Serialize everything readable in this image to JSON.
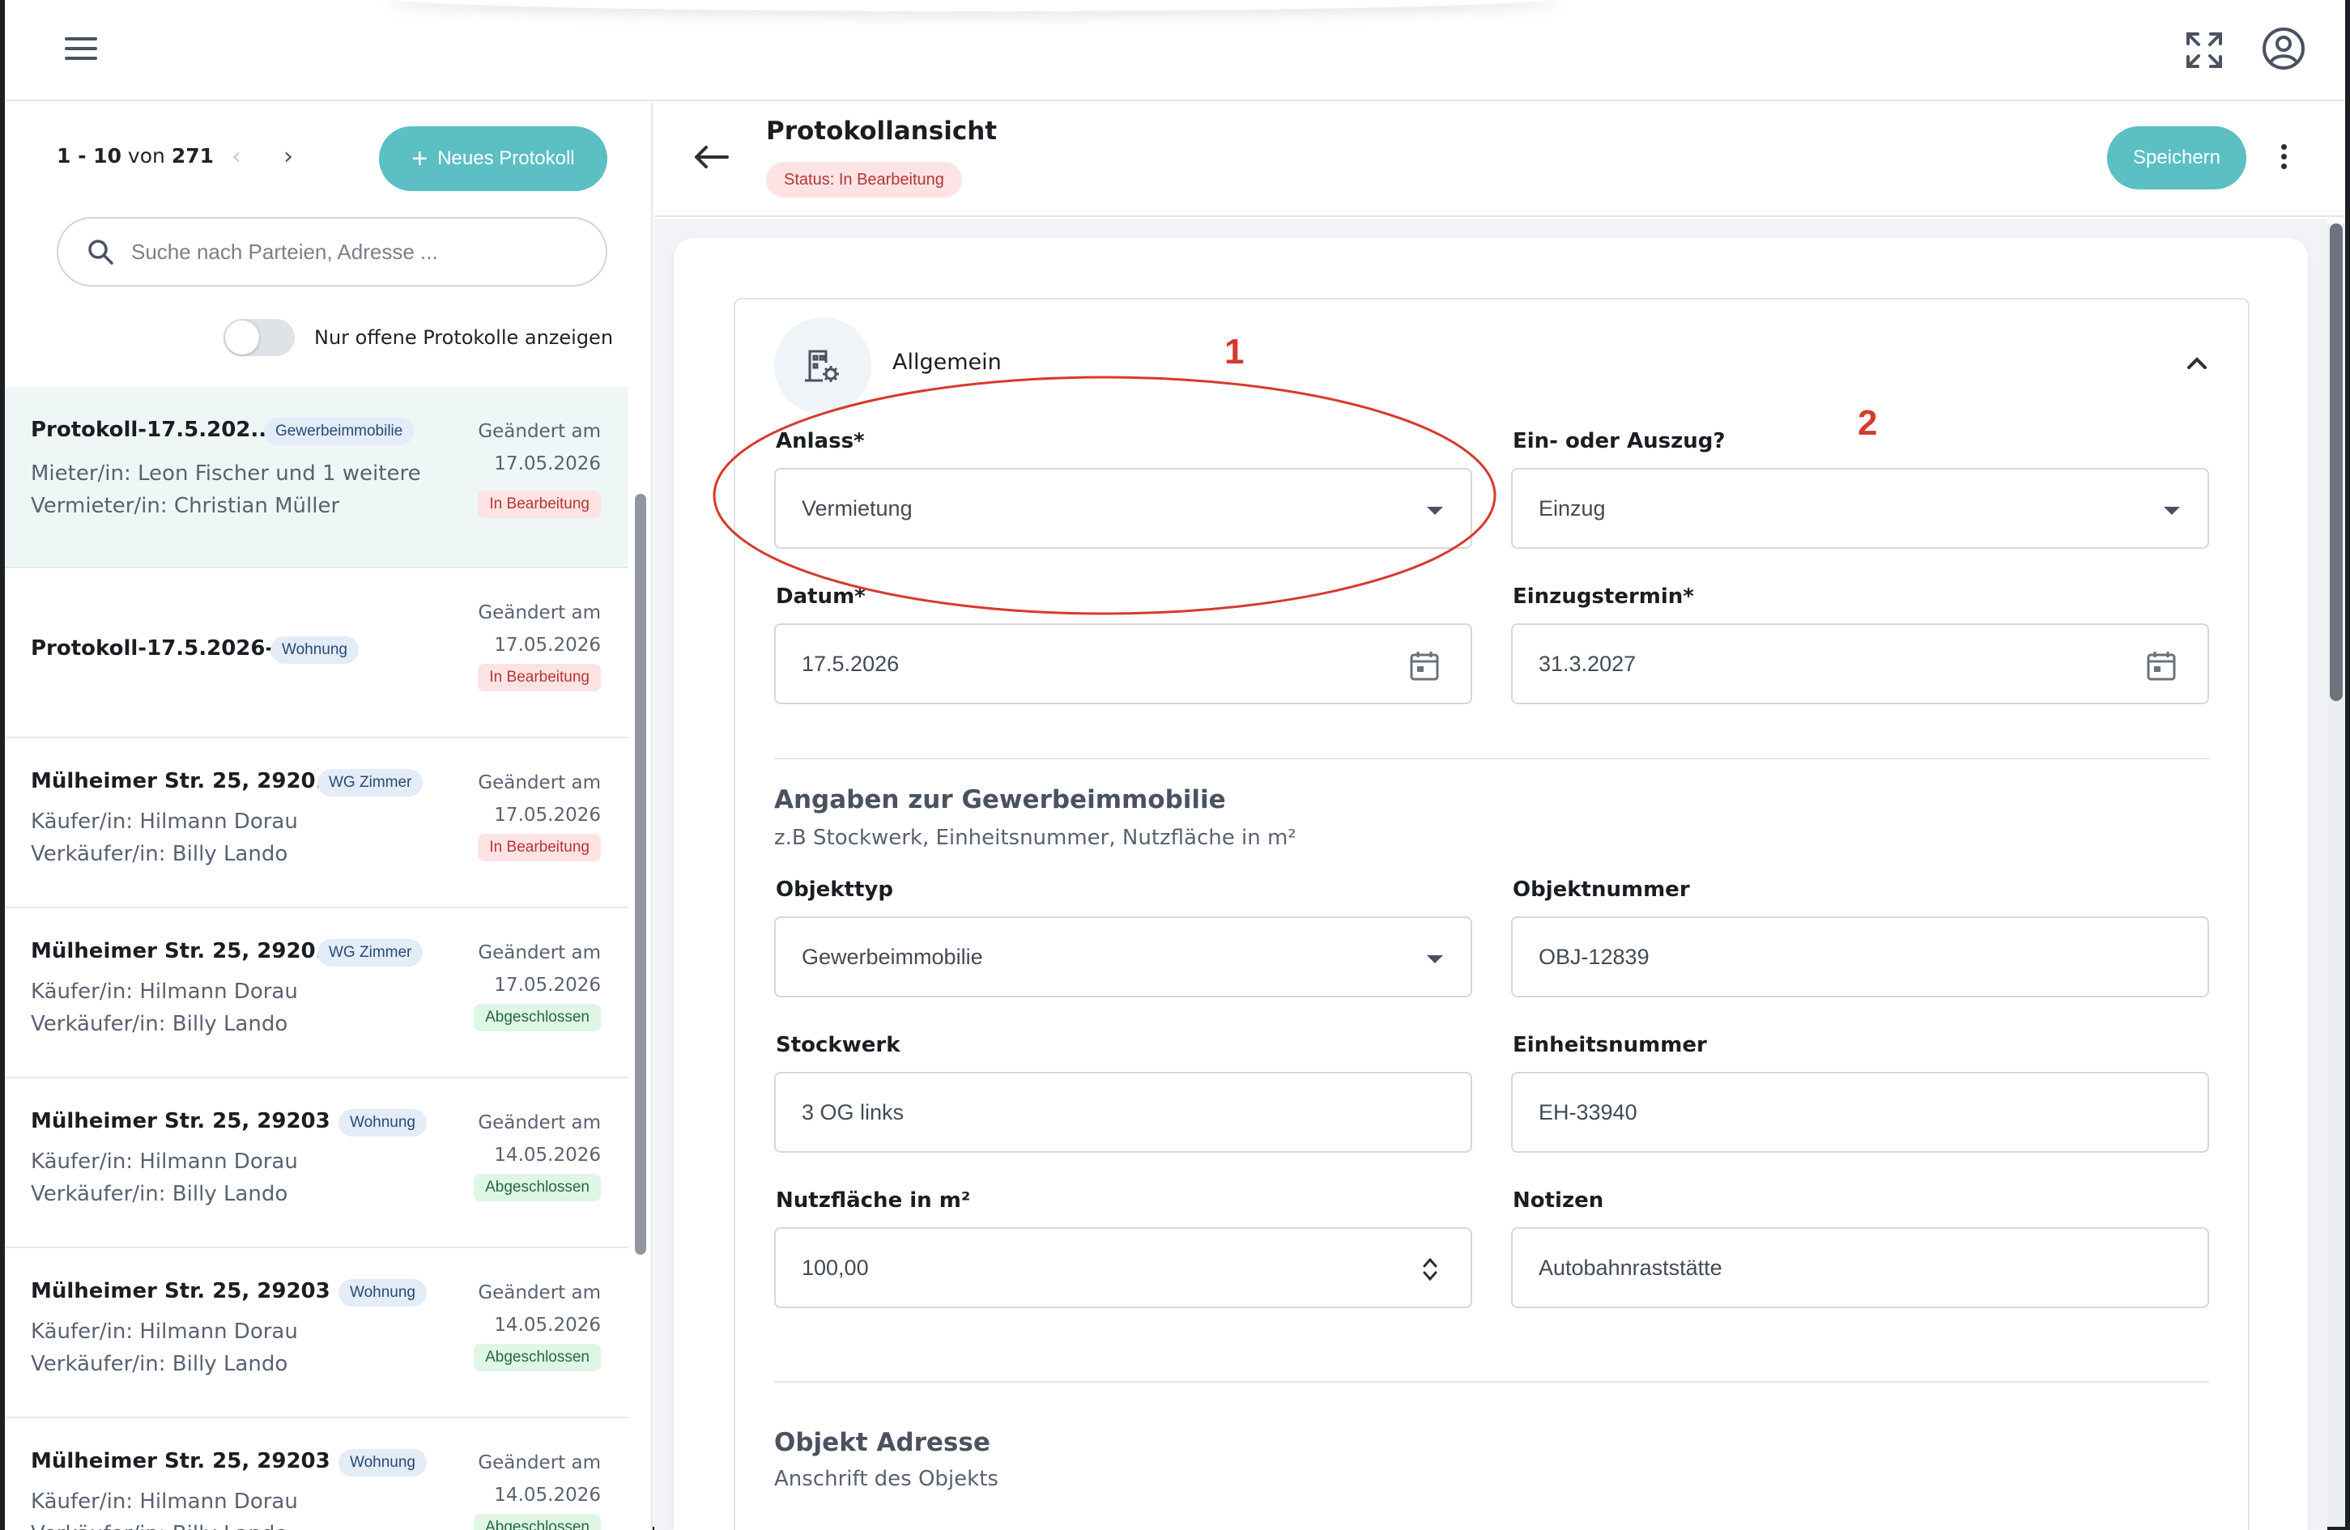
{
  "topbar": {
    "menu_icon": "hamburger-menu-icon",
    "fullscreen_icon": "expand-icon",
    "account_icon": "user-account-icon"
  },
  "left": {
    "pager": {
      "range": "1 - 10",
      "of": "von",
      "total": "271"
    },
    "new_button": "Neues Protokoll",
    "search_placeholder": "Suche nach Parteien, Adresse ...",
    "toggle_label": "Nur offene Protokolle anzeigen",
    "items": [
      {
        "title": "Protokoll-17.5.202...",
        "chip": "Gewerbeimmobilie",
        "line1": "Mieter/in: Leon Fischer und 1 weitere",
        "line2": "Vermieter/in: Christian Müller",
        "changed": "Geändert am",
        "date": "17.05.2026",
        "status": "In Bearbeitung"
      },
      {
        "title": "Protokoll-17.5.2026-2",
        "chip": "Wohnung",
        "line1": "",
        "line2": "",
        "changed": "Geändert am",
        "date": "17.05.2026",
        "status": "In Bearbeitung"
      },
      {
        "title": "Mülheimer Str. 25, 2920...",
        "chip": "WG Zimmer",
        "line1": "Käufer/in: Hilmann Dorau",
        "line2": "Verkäufer/in: Billy Lando",
        "changed": "Geändert am",
        "date": "17.05.2026",
        "status": "In Bearbeitung"
      },
      {
        "title": "Mülheimer Str. 25, 2920...",
        "chip": "WG Zimmer",
        "line1": "Käufer/in: Hilmann Dorau",
        "line2": "Verkäufer/in: Billy Lando",
        "changed": "Geändert am",
        "date": "17.05.2026",
        "status": "Abgeschlossen"
      },
      {
        "title": "Mülheimer Str. 25, 29203 ...",
        "chip": "Wohnung",
        "line1": "Käufer/in: Hilmann Dorau",
        "line2": "Verkäufer/in: Billy Lando",
        "changed": "Geändert am",
        "date": "14.05.2026",
        "status": "Abgeschlossen"
      },
      {
        "title": "Mülheimer Str. 25, 29203 ...",
        "chip": "Wohnung",
        "line1": "Käufer/in: Hilmann Dorau",
        "line2": "Verkäufer/in: Billy Lando",
        "changed": "Geändert am",
        "date": "14.05.2026",
        "status": "Abgeschlossen"
      },
      {
        "title": "Mülheimer Str. 25, 29203 ...",
        "chip": "Wohnung",
        "line1": "Käufer/in: Hilmann Dorau",
        "line2": "Verkäufer/in: Billy Lando",
        "changed": "Geändert am",
        "date": "14.05.2026",
        "status": "Abgeschlossen"
      }
    ]
  },
  "header": {
    "title": "Protokollansicht",
    "status_label": "Status:",
    "status_value": "In Bearbeitung",
    "save_button": "Speichern"
  },
  "form": {
    "section_title": "Allgemein",
    "anlass": {
      "label": "Anlass*",
      "value": "Vermietung"
    },
    "ein_aus": {
      "label": "Ein- oder Auszug?",
      "value": "Einzug"
    },
    "datum": {
      "label": "Datum*",
      "value": "17.5.2026"
    },
    "einzugstermin": {
      "label": "Einzugstermin*",
      "value": "31.3.2027"
    },
    "gewerbe": {
      "title": "Angaben zur Gewerbeimmobilie",
      "hint": "z.B Stockwerk, Einheitsnummer, Nutzfläche in m²"
    },
    "objekttyp": {
      "label": "Objekttyp",
      "value": "Gewerbeimmobilie"
    },
    "objektnummer": {
      "label": "Objektnummer",
      "value": "OBJ-12839"
    },
    "stockwerk": {
      "label": "Stockwerk",
      "value": "3 OG links"
    },
    "einheitsnummer": {
      "label": "Einheitsnummer",
      "value": "EH-33940"
    },
    "nutzflaeche": {
      "label": "Nutzfläche in m²",
      "value": "100,00"
    },
    "notizen": {
      "label": "Notizen",
      "value": "Autobahnraststätte"
    },
    "adresse": {
      "title": "Objekt Adresse",
      "hint": "Anschrift des Objekts"
    }
  },
  "annotations": {
    "one": "1",
    "two": "2",
    "color": "#d63a2c"
  },
  "colors": {
    "accent": "#5bbfc4",
    "status_red_bg": "#fde3e3",
    "status_green_bg": "#dff5e6"
  }
}
